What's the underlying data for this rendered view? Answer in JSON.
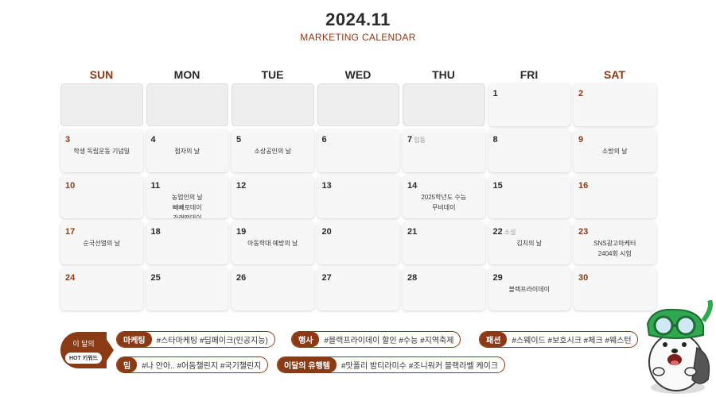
{
  "header": {
    "year": "2024.11",
    "subtitle": "MARKETING CALENDAR"
  },
  "day_names": [
    "SUN",
    "MON",
    "TUE",
    "WED",
    "THU",
    "FRI",
    "SAT"
  ],
  "weeks": [
    [
      {
        "day": "",
        "events": []
      },
      {
        "day": "",
        "events": []
      },
      {
        "day": "",
        "events": []
      },
      {
        "day": "",
        "events": []
      },
      {
        "day": "",
        "events": []
      },
      {
        "day": "1",
        "events": []
      },
      {
        "day": "2",
        "events": []
      }
    ],
    [
      {
        "day": "3",
        "events": [
          "학생 독립운동 기념일"
        ]
      },
      {
        "day": "4",
        "events": [
          "점자의 날"
        ]
      },
      {
        "day": "5",
        "events": [
          "소상공인의 날"
        ]
      },
      {
        "day": "6",
        "events": []
      },
      {
        "day": "7",
        "tag": "입동",
        "events": []
      },
      {
        "day": "8",
        "events": []
      },
      {
        "day": "9",
        "events": [
          "소방의 날"
        ]
      }
    ],
    [
      {
        "day": "10",
        "events": []
      },
      {
        "day": "11",
        "events": [
          "농업인의 날",
          "빼빼로데이",
          "가래떡데이"
        ]
      },
      {
        "day": "12",
        "events": []
      },
      {
        "day": "13",
        "events": []
      },
      {
        "day": "14",
        "events": [
          "2025학년도 수능",
          "무비데이"
        ]
      },
      {
        "day": "15",
        "events": []
      },
      {
        "day": "16",
        "events": []
      }
    ],
    [
      {
        "day": "17",
        "events": [
          "순국선열의 날"
        ]
      },
      {
        "day": "18",
        "events": []
      },
      {
        "day": "19",
        "events": [
          "아동학대 예방의 날"
        ]
      },
      {
        "day": "20",
        "events": []
      },
      {
        "day": "21",
        "events": []
      },
      {
        "day": "22",
        "tag": "소설",
        "events": [
          "김치의 날"
        ]
      },
      {
        "day": "23",
        "events": [
          "SNS광고마케터",
          "2404회 시험"
        ]
      }
    ],
    [
      {
        "day": "24",
        "events": []
      },
      {
        "day": "25",
        "events": []
      },
      {
        "day": "26",
        "events": []
      },
      {
        "day": "27",
        "events": []
      },
      {
        "day": "28",
        "events": []
      },
      {
        "day": "29",
        "events": [
          "블랙프라이데이"
        ]
      },
      {
        "day": "30",
        "events": []
      }
    ]
  ],
  "keywords": {
    "badge_line1": "이 달의",
    "badge_line2": "HOT 키워드",
    "items": [
      {
        "label": "마케팅",
        "text": "#스타마케팅 #딥페이크(인공지능)"
      },
      {
        "label": "행사",
        "text": "#블랙프라이데이 할인 #수능 #지역축제"
      },
      {
        "label": "패션",
        "text": "#스웨이드 #보호시크 #체크 #웨스턴"
      },
      {
        "label": "밈",
        "text": "#나 안아.. #어둠챌린지 #국기챌린지"
      },
      {
        "label": "이달의 유행템",
        "text": "#맛폴리 밤티라미수 #조니워커 블랙라벨 케이크"
      }
    ]
  },
  "colors": {
    "accent": "#8a3a14",
    "cell_bg": "#f7f7f7",
    "empty_bg": "#eeeeee",
    "mascot_green": "#2fa84f"
  },
  "mascot_icon": "seal-with-goggles-mascot"
}
